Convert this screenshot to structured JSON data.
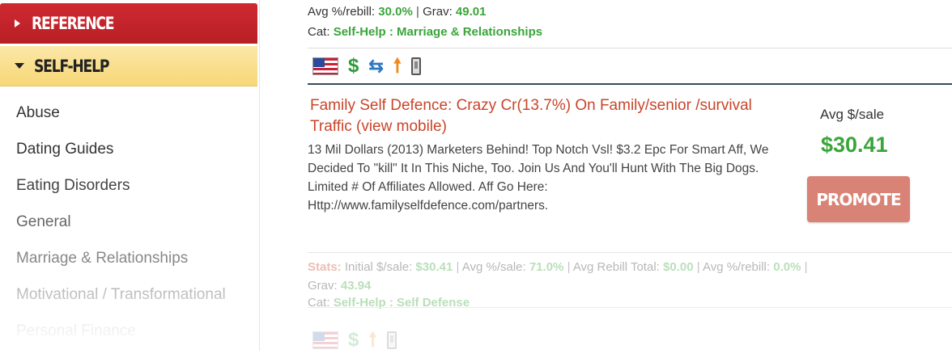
{
  "sidebar": {
    "reference_label": "REFERENCE",
    "selfhelp_label": "SELF-HELP",
    "subcategories": [
      {
        "label": "Abuse",
        "color": "#333333"
      },
      {
        "label": "Dating Guides",
        "color": "#333333"
      },
      {
        "label": "Eating Disorders",
        "color": "#444444"
      },
      {
        "label": "General",
        "color": "#666666"
      },
      {
        "label": "Marriage & Relationships",
        "color": "#888888"
      },
      {
        "label": "Motivational / Transformational",
        "color": "#aaaaaa"
      },
      {
        "label": "Personal Finance",
        "color": "#cccccc"
      }
    ]
  },
  "prev_listing": {
    "avg_rebill_label": "Avg %/rebill:",
    "avg_rebill_value": "30.0%",
    "grav_label": "Grav:",
    "grav_value": "49.01",
    "cat_label": "Cat:",
    "cat_value": "Self-Help : Marriage & Relationships"
  },
  "icons": [
    "us-flag-icon",
    "dollar-icon",
    "recurring-icon",
    "up-arrow-icon",
    "mobile-icon"
  ],
  "listing": {
    "title": "Family Self Defence: Crazy Cr(13.7%) On Family/senior /survival Traffic (view mobile)",
    "description": "13 Mil Dollars (2013) Marketers Behind! Top Notch Vsl! $3.2 Epc For Smart Aff, We Decided To \"kill\" It In This Niche, Too. Join Us And You'll Hunt With The Big Dogs. Limited # Of Affiliates Allowed. Aff Go Here: Http://www.familyselfdefence.com/partners.",
    "avg_sale_label": "Avg $/sale",
    "avg_sale_value": "$30.41",
    "promote_label": "PROMOTE",
    "stats_label": "Stats:",
    "initial_sale_label": "Initial $/sale:",
    "initial_sale_value": "$30.41",
    "avg_pct_sale_label": "Avg %/sale:",
    "avg_pct_sale_value": "71.0%",
    "avg_rebill_total_label": "Avg Rebill Total:",
    "avg_rebill_total_value": "$0.00",
    "avg_rebill_label": "Avg %/rebill:",
    "avg_rebill_value": "0.0%",
    "grav_label": "Grav:",
    "grav_value": "43.94",
    "cat_label": "Cat:",
    "cat_value": "Self-Help : Self Defense"
  },
  "colors": {
    "reference_bg": "#c9252c",
    "selfhelp_bg": "#f9dd88",
    "green": "#3aa53a",
    "title_red": "#c9452a",
    "promote_bg": "#d98276"
  }
}
